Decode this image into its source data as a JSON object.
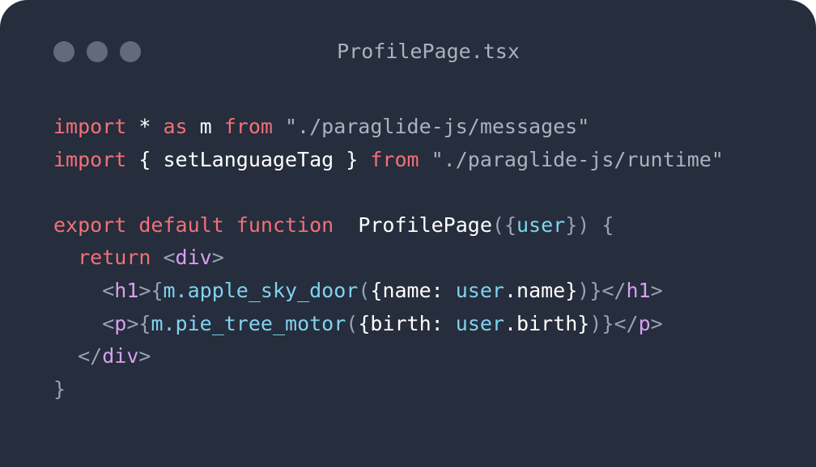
{
  "window": {
    "title": "ProfilePage.tsx",
    "controls": [
      "close",
      "minimize",
      "maximize"
    ]
  },
  "code": {
    "language": "tsx",
    "lines": [
      "import * as m from \"./paraglide-js/messages\"",
      "import { setLanguageTag } from \"./paraglide-js/runtime\"",
      "",
      "export default function  ProfilePage({user}) {",
      "  return <div>",
      "    <h1>{m.apple_sky_door({name: user.name})}</h1>",
      "    <p>{m.pie_tree_motor({birth: user.birth})}</p>",
      "  </div>",
      "}"
    ]
  },
  "colors": {
    "background": "#262d3c",
    "keyword": "#f07178",
    "string": "#a9b2c0",
    "punctuation": "#98a2b3",
    "jsx_tag": "#d7a0f0",
    "identifier": "#7fd3f0",
    "plain": "#ffffff",
    "window_dot": "#636b7b"
  }
}
